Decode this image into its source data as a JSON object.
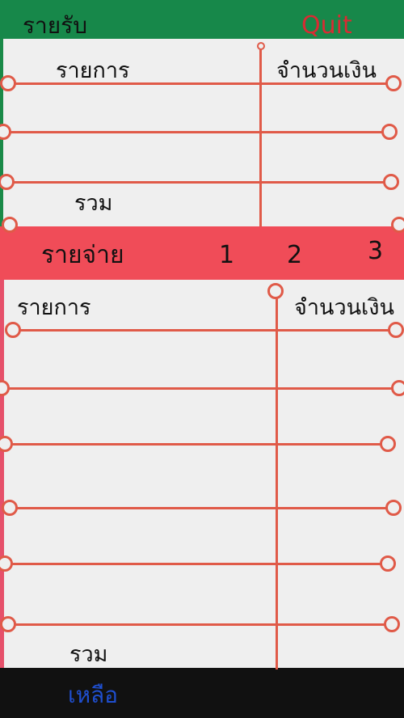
{
  "income": {
    "title": "รายรับ",
    "quit_label": "Quit",
    "col_item": "รายการ",
    "col_amount": "จำนวนเงิน",
    "total_label": "รวม"
  },
  "expense": {
    "title": "รายจ่าย",
    "pages": [
      "1",
      "2",
      "3"
    ],
    "col_item": "รายการ",
    "col_amount": "จำนวนเงิน",
    "total_label": "รวม"
  },
  "footer": {
    "balance_label": "เหลือ"
  },
  "colors": {
    "income_band": "#17884a",
    "expense_band": "#f04c58",
    "rule": "#e05a48",
    "quit": "#d92b33",
    "balance": "#1f4fd0"
  }
}
